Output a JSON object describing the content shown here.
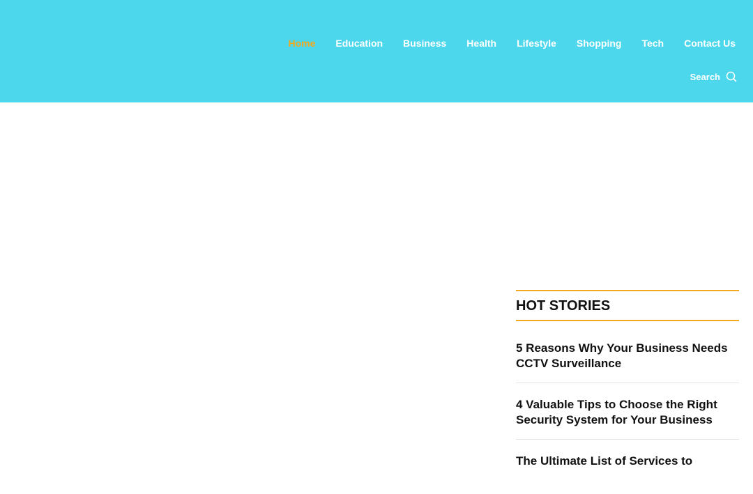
{
  "header": {
    "nav": [
      {
        "label": "Home",
        "active": true
      },
      {
        "label": "Education",
        "active": false
      },
      {
        "label": "Business",
        "active": false
      },
      {
        "label": "Health",
        "active": false
      },
      {
        "label": "Lifestyle",
        "active": false
      },
      {
        "label": "Shopping",
        "active": false
      },
      {
        "label": "Tech",
        "active": false
      },
      {
        "label": "Contact Us",
        "active": false
      }
    ],
    "search_label": "Search",
    "search_icon": "search-icon"
  },
  "colors": {
    "header_bg": "#4cd7ec",
    "accent": "#f4a81d",
    "text_dark": "#111111"
  },
  "sidebar": {
    "hot_stories_title": "HOT STORIES",
    "stories": [
      {
        "title": "5 Reasons Why Your Business Needs CCTV Surveillance"
      },
      {
        "title": "4 Valuable Tips to Choose the Right Security System for Your Business"
      },
      {
        "title": "The Ultimate List of Services to"
      }
    ]
  }
}
